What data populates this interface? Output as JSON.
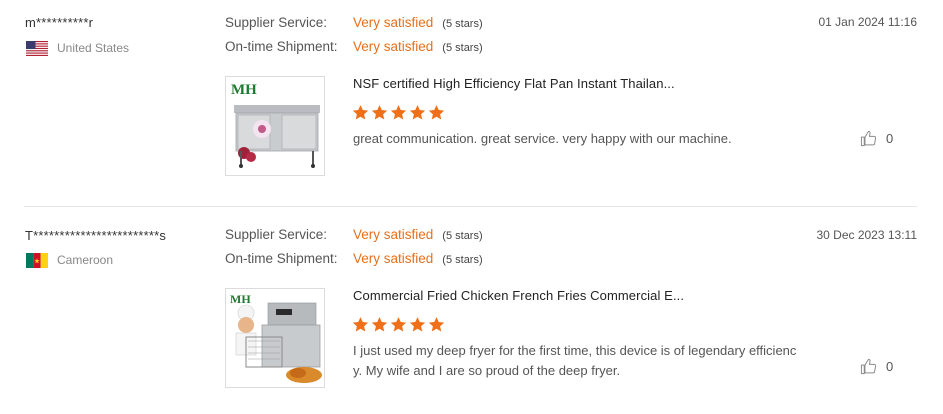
{
  "reviews": [
    {
      "buyer": "m**********r",
      "country": "United States",
      "flag_icon": "us-flag-icon",
      "supplier_service_label": "Supplier Service:",
      "supplier_service_value": "Very satisfied",
      "supplier_service_stars": "(5 stars)",
      "shipment_label": "On-time Shipment:",
      "shipment_value": "Very satisfied",
      "shipment_stars": "(5 stars)",
      "date": "01 Jan 2024 11:16",
      "product_title": "NSF certified High Efficiency Flat Pan Instant Thailan...",
      "product_thumb_logo": "MH",
      "rating": 5,
      "comment": "great communication. great service. very happy with our machine.",
      "likes": "0"
    },
    {
      "buyer": "T************************s",
      "country": "Cameroon",
      "flag_icon": "cameroon-flag-icon",
      "supplier_service_label": "Supplier Service:",
      "supplier_service_value": "Very satisfied",
      "supplier_service_stars": "(5 stars)",
      "shipment_label": "On-time Shipment:",
      "shipment_value": "Very satisfied",
      "shipment_stars": "(5 stars)",
      "date": "30 Dec 2023 13:11",
      "product_title": "Commercial Fried Chicken French Fries Commercial E...",
      "product_thumb_logo": "MH",
      "rating": 5,
      "comment": "I just used my deep fryer for the first time, this device is of legendary efficiency. My wife and I are so proud of the deep fryer.",
      "likes": "0"
    }
  ],
  "colors": {
    "accent": "#e8701a",
    "star": "#f07019",
    "divider": "#e6e6e6"
  }
}
